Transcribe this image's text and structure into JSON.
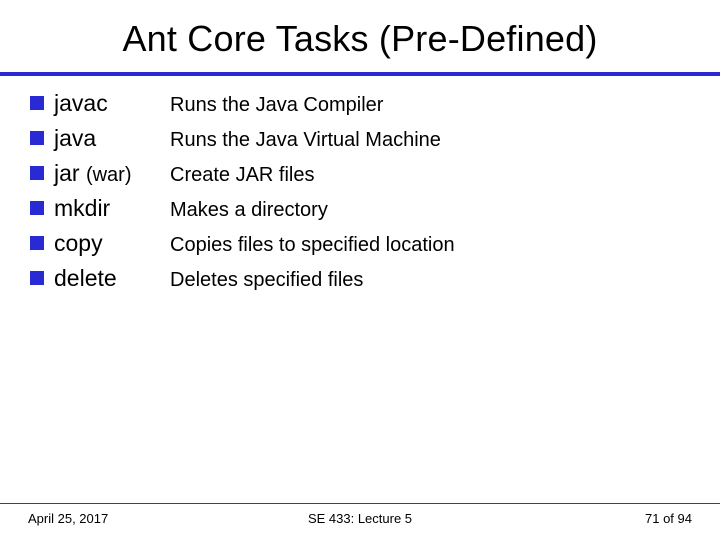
{
  "title": "Ant Core Tasks (Pre-Defined)",
  "items": [
    {
      "task": "javac",
      "paren": "",
      "desc": "Runs the Java Compiler"
    },
    {
      "task": "java",
      "paren": "",
      "desc": "Runs the Java Virtual Machine"
    },
    {
      "task": "jar",
      "paren": "(war)",
      "desc": "Create JAR files"
    },
    {
      "task": "mkdir",
      "paren": "",
      "desc": "Makes a directory"
    },
    {
      "task": "copy",
      "paren": "",
      "desc": "Copies files to specified location"
    },
    {
      "task": "delete",
      "paren": "",
      "desc": "Deletes specified files"
    }
  ],
  "footer": {
    "date": "April 25, 2017",
    "course": "SE 433: Lecture 5",
    "page_current": "71",
    "page_sep": " of ",
    "page_total": "94"
  }
}
